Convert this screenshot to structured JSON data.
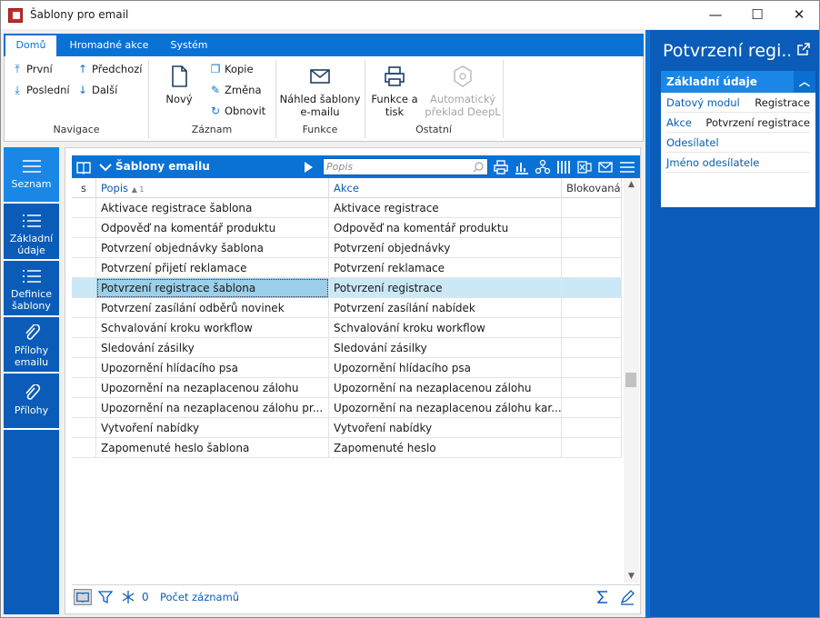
{
  "window": {
    "title": "Šablony pro email",
    "minimize": "—",
    "maximize": "☐",
    "close": "✕"
  },
  "ribbon": {
    "tabs": [
      "Domů",
      "Hromadné akce",
      "Systém"
    ],
    "navigace": {
      "label": "Navigace",
      "first": "První",
      "prev": "Předchozí",
      "last": "Poslední",
      "next": "Další"
    },
    "zaznam": {
      "label": "Záznam",
      "new": "Nový",
      "copy": "Kopie",
      "change": "Změna",
      "refresh": "Obnovit"
    },
    "funkce": {
      "label": "Funkce",
      "preview_line1": "Náhled šablony",
      "preview_line2": "e-mailu"
    },
    "ostatni": {
      "label": "Ostatní",
      "print_line1": "Funkce a",
      "print_line2": "tisk",
      "deepl_line1": "Automatický",
      "deepl_line2": "překlad DeepL"
    }
  },
  "leftnav": [
    {
      "line1": "Seznam",
      "line2": "",
      "icon": "list-icon"
    },
    {
      "line1": "Základní",
      "line2": "údaje",
      "icon": "list-icon"
    },
    {
      "line1": "Definice",
      "line2": "šablony",
      "icon": "list-icon"
    },
    {
      "line1": "Přílohy",
      "line2": "emailu",
      "icon": "paperclip-icon"
    },
    {
      "line1": "Přílohy",
      "line2": "",
      "icon": "paperclip-icon"
    }
  ],
  "grid": {
    "title": "Šablony emailu",
    "search_placeholder": "Popis",
    "columns": {
      "s": "s",
      "popis": "Popis",
      "sort": "▲ 1",
      "akce": "Akce",
      "blokovana": "Blokovaná"
    },
    "rows": [
      {
        "popis": "Aktivace registrace šablona",
        "akce": "Aktivace registrace"
      },
      {
        "popis": "Odpověď na komentář produktu",
        "akce": "Odpověď na komentář produktu"
      },
      {
        "popis": "Potvrzení objednávky šablona",
        "akce": "Potvrzení objednávky"
      },
      {
        "popis": "Potvrzení přijetí reklamace",
        "akce": "Potvrzení reklamace"
      },
      {
        "popis": "Potvrzení registrace šablona",
        "akce": "Potvrzení registrace"
      },
      {
        "popis": "Potvrzení zasílání odběrů novinek",
        "akce": "Potvrzení zasílání nabídek"
      },
      {
        "popis": "Schvalování kroku workflow",
        "akce": "Schvalování kroku workflow"
      },
      {
        "popis": "Sledování zásilky",
        "akce": "Sledování zásilky"
      },
      {
        "popis": "Upozornění hlídacího psa",
        "akce": "Upozornění hlídacího psa"
      },
      {
        "popis": "Upozornění na nezaplacenou zálohu",
        "akce": "Upozornění na nezaplacenou zálohu"
      },
      {
        "popis": "Upozornění na nezaplacenou zálohu pr...",
        "akce": "Upozornění na nezaplacenou zálohu kar..."
      },
      {
        "popis": "Vytvoření nabídky",
        "akce": "Vytvoření nabídky"
      },
      {
        "popis": "Zapomenuté heslo šablona",
        "akce": "Zapomenuté heslo"
      }
    ],
    "selected_index": 4,
    "footer": {
      "filter_count": "0",
      "record_count": "Počet záznamů"
    }
  },
  "rightpanel": {
    "title": "Potvrzení regi...",
    "section": "Základní údaje",
    "fields": [
      {
        "label": "Datový modul",
        "value": "Registrace"
      },
      {
        "label": "Akce",
        "value": "Potvrzení registrace"
      },
      {
        "label": "Odesílatel",
        "value": ""
      },
      {
        "label": "Jméno odesílatele",
        "value": ""
      }
    ]
  },
  "colors": {
    "accent": "#0a72d5",
    "dark": "#0a5cb8",
    "selected_row": "#cbe8f6"
  }
}
